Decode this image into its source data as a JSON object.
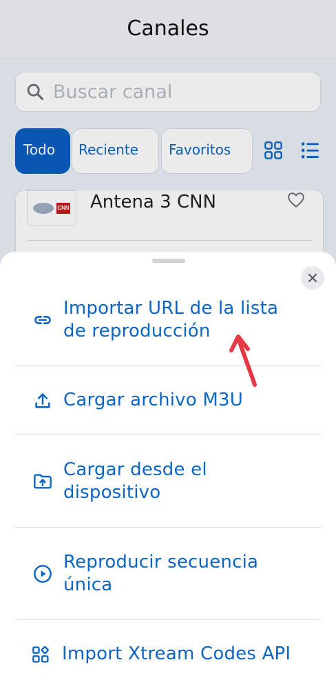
{
  "header": {
    "title": "Canales"
  },
  "search": {
    "placeholder": "Buscar canal"
  },
  "tabs": [
    {
      "label": "Todo",
      "active": true
    },
    {
      "label": "Reciente",
      "active": false
    },
    {
      "label": "Favoritos",
      "active": false
    }
  ],
  "view_icons": [
    "grid-view-icon",
    "list-view-icon"
  ],
  "channel": {
    "name": "Antena 3 CNN",
    "logo_text": "CNN"
  },
  "sheet": {
    "options": [
      {
        "label_lines": [
          "Importar URL de la lista",
          "de reproducción"
        ],
        "icon": "link-icon"
      },
      {
        "label_lines": [
          "Cargar archivo M3U"
        ],
        "icon": "upload-icon"
      },
      {
        "label_lines": [
          "Cargar desde el",
          "dispositivo"
        ],
        "icon": "folder-upload-icon"
      },
      {
        "label_lines": [
          "Reproducir secuencia",
          "única"
        ],
        "icon": "play-circle-icon"
      },
      {
        "label_lines": [
          "Import Xtream Codes API"
        ],
        "icon": "apps-grid-icon"
      }
    ]
  },
  "colors": {
    "accent": "#0b65c5",
    "annotation_arrow": "#e53946"
  }
}
